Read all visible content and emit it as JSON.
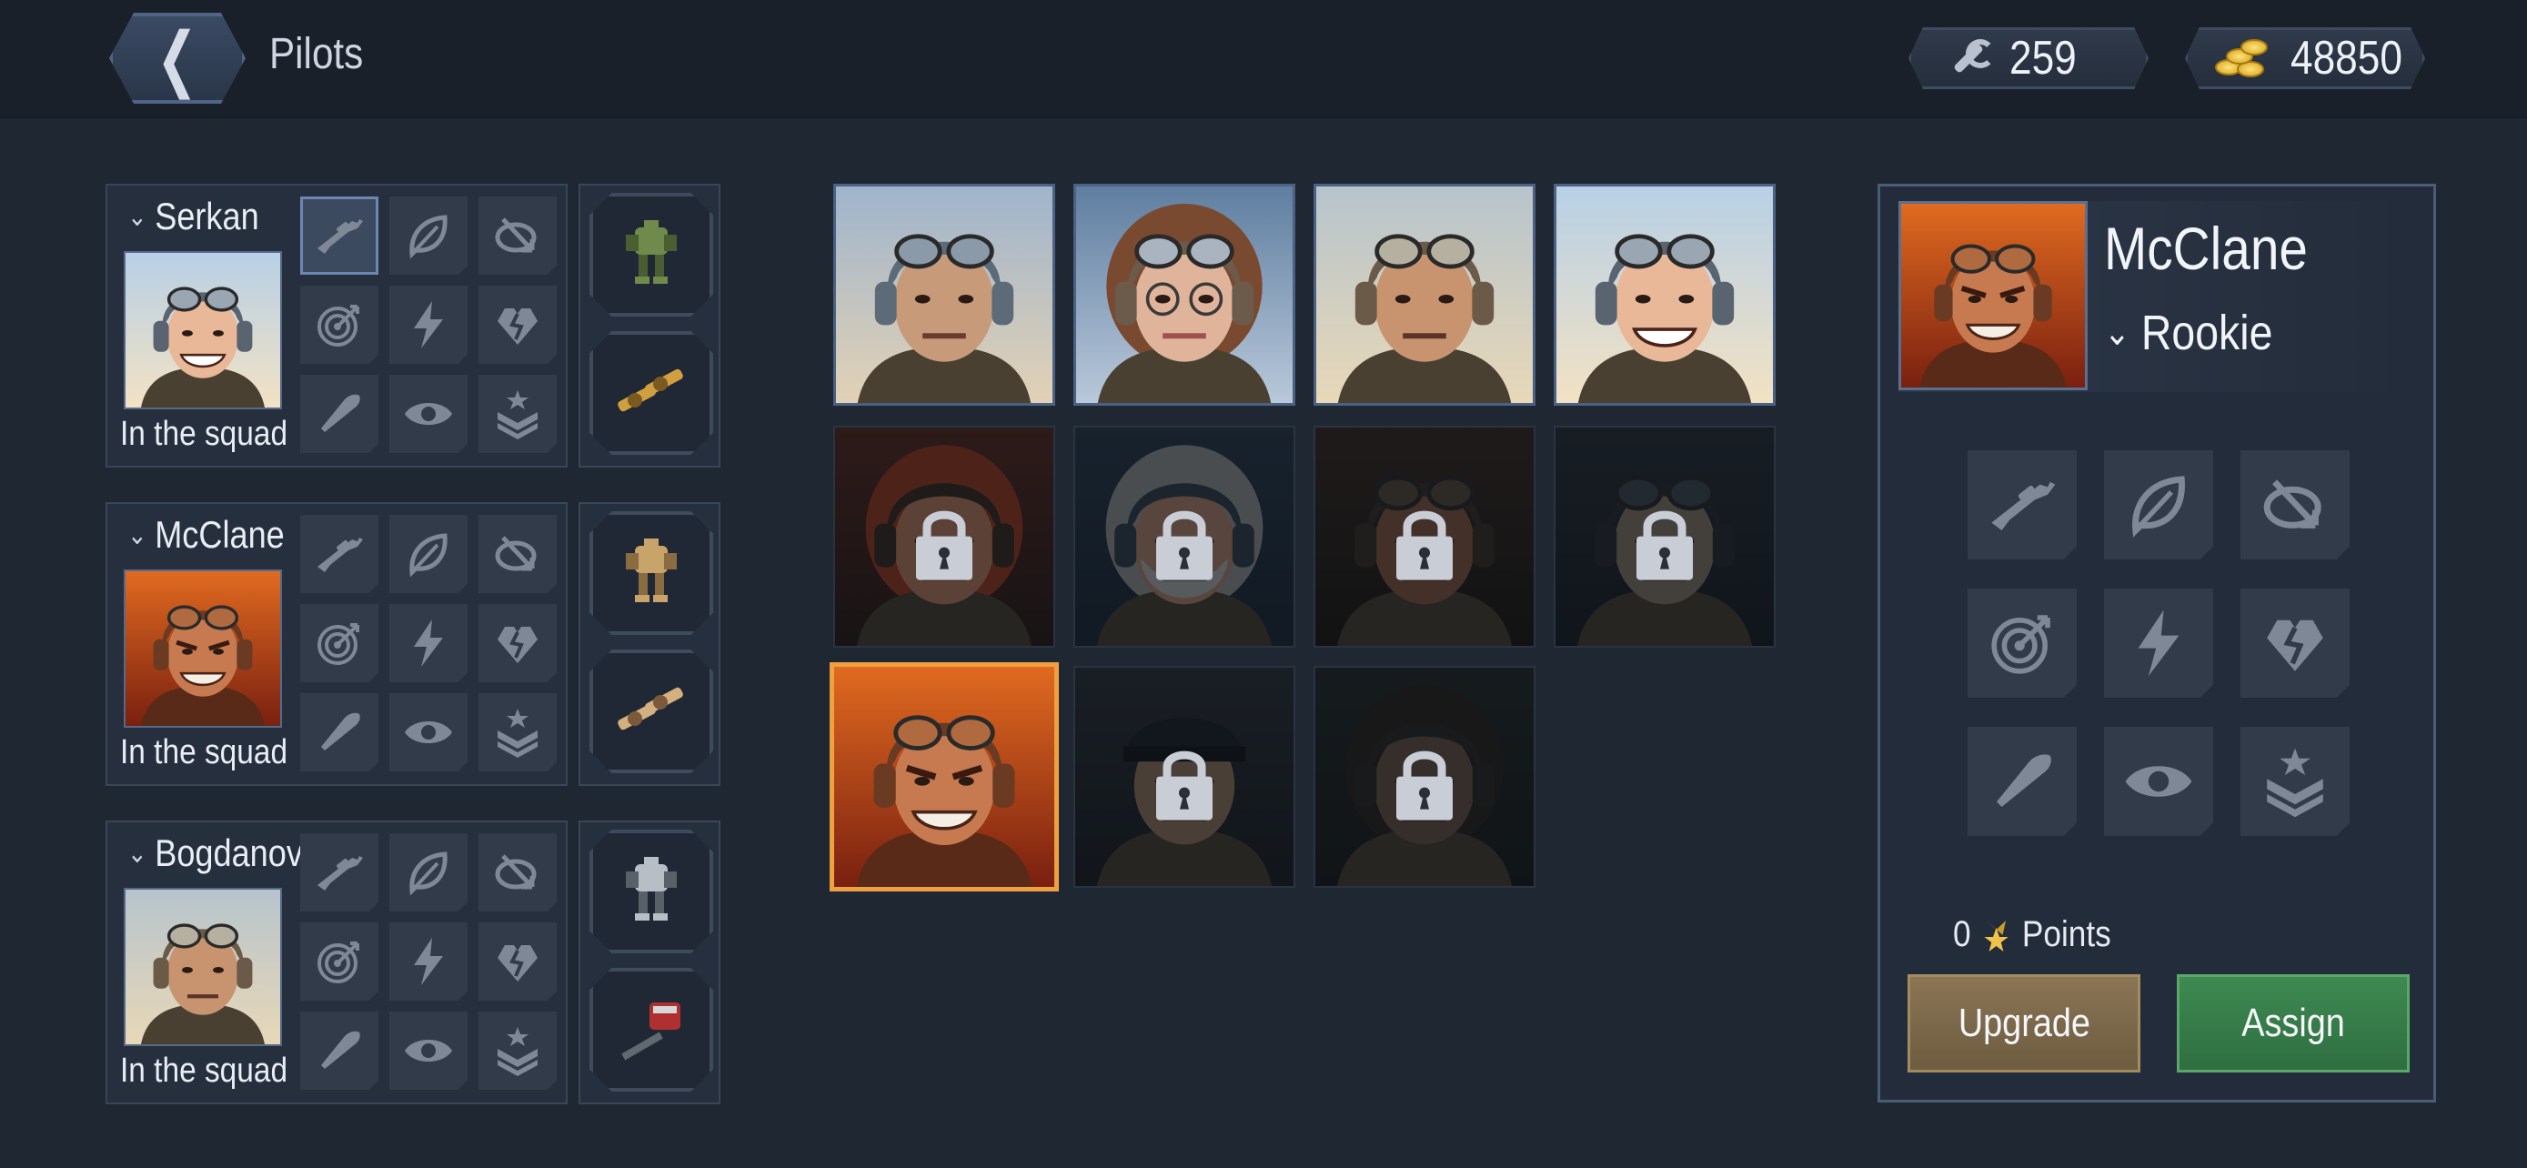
{
  "header": {
    "title": "Pilots",
    "back_icon": "chevron-left-icon",
    "parts": {
      "icon": "wrench-icon",
      "value": "259"
    },
    "gold": {
      "icon": "coins-icon",
      "value": "48850"
    }
  },
  "squad": [
    {
      "name": "Serkan",
      "status": "In the squad",
      "active_skill": 0
    },
    {
      "name": "McClane",
      "status": "In the squad",
      "active_skill": -1
    },
    {
      "name": "Bogdanov",
      "status": "In the squad",
      "active_skill": -1
    }
  ],
  "skill_icons": [
    "sniper-rifle-icon",
    "leaf-icon",
    "target-arrow-icon",
    "crosshair-target-icon",
    "lightning-icon",
    "broken-heart-icon",
    "bullet-icon",
    "eye-icon",
    "rank-chevron-star-icon"
  ],
  "roster": [
    {
      "locked": false,
      "selected": false
    },
    {
      "locked": false,
      "selected": false
    },
    {
      "locked": false,
      "selected": false
    },
    {
      "locked": false,
      "selected": false
    },
    {
      "locked": true,
      "selected": false
    },
    {
      "locked": true,
      "selected": false
    },
    {
      "locked": true,
      "selected": false
    },
    {
      "locked": true,
      "selected": false
    },
    {
      "locked": false,
      "selected": true
    },
    {
      "locked": true,
      "selected": false
    },
    {
      "locked": true,
      "selected": false
    }
  ],
  "detail": {
    "name": "McClane",
    "rank": "Rookie",
    "points_value": "0",
    "points_label": "Points",
    "upgrade_label": "Upgrade",
    "assign_label": "Assign"
  },
  "colors": {
    "background": "#1f2733",
    "selected_border": "#f0a040",
    "upgrade": "#7d6a4b",
    "assign": "#3a7d4b"
  }
}
